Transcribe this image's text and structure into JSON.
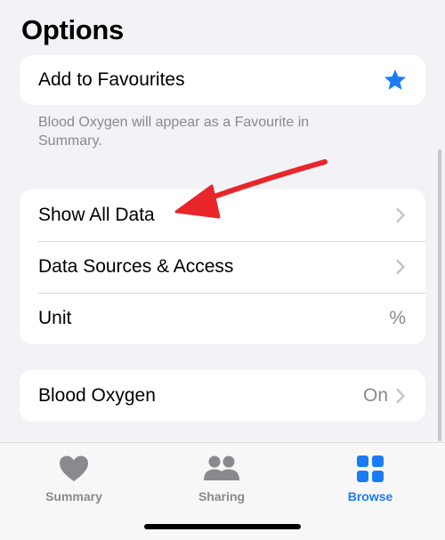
{
  "options": {
    "title": "Options",
    "favourite": {
      "label": "Add to Favourites",
      "footnote": "Blood Oxygen will appear as a Favourite in Summary."
    },
    "rows": [
      {
        "label": "Show All Data",
        "value": ""
      },
      {
        "label": "Data Sources & Access",
        "value": ""
      },
      {
        "label": "Unit",
        "value": "%"
      }
    ],
    "blood_oxygen": {
      "label": "Blood Oxygen",
      "value": "On"
    }
  },
  "tabbar": {
    "summary": "Summary",
    "sharing": "Sharing",
    "browse": "Browse"
  },
  "colors": {
    "accent": "#1a7cf5",
    "annotation_arrow": "#e8262a",
    "secondary_text": "#8a8a8e",
    "background": "#f2f2f7"
  },
  "icons": {
    "favourite": "star-icon",
    "disclosure": "chevron-right-icon",
    "summary": "heart-icon",
    "sharing": "people-icon",
    "browse": "grid-icon"
  }
}
